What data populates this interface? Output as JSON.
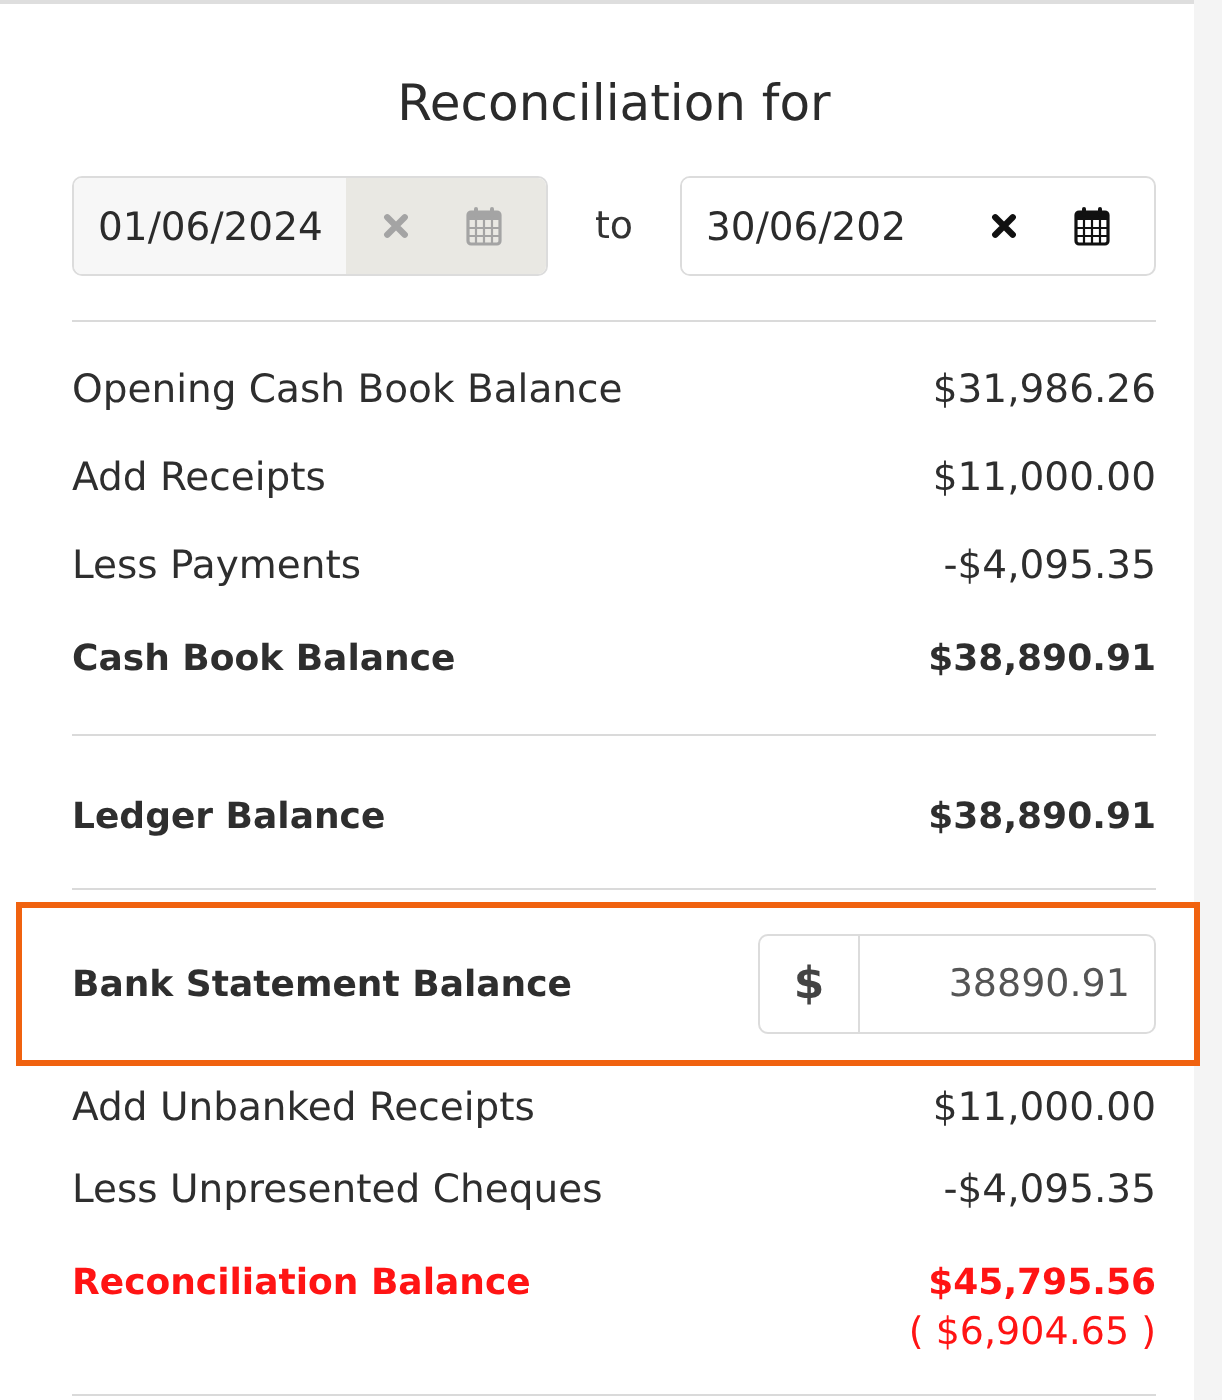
{
  "title": "Reconciliation for",
  "date_range": {
    "from": {
      "value": "01/06/2024",
      "disabled": true
    },
    "separator": "to",
    "to": {
      "value": "30/06/202",
      "disabled": false
    }
  },
  "sections": [
    {
      "rows": [
        {
          "label": "Opening Cash Book Balance",
          "amount": "$31,986.26",
          "total": false
        },
        {
          "label": "Add Receipts",
          "amount": "$11,000.00",
          "total": false
        },
        {
          "label": "Less Payments",
          "amount": "-$4,095.35",
          "total": false
        },
        {
          "label": "Cash Book Balance",
          "amount": "$38,890.91",
          "total": true
        }
      ]
    },
    {
      "rows": [
        {
          "label": "Ledger Balance",
          "amount": "$38,890.91",
          "total": true
        }
      ]
    }
  ],
  "bank_statement": {
    "label": "Bank Statement Balance",
    "currency": "$",
    "value": "38890.91",
    "highlighted": true
  },
  "adjustments": [
    {
      "label": "Add Unbanked Receipts",
      "amount": "$11,000.00"
    },
    {
      "label": "Less Unpresented Cheques",
      "amount": "-$4,095.35"
    }
  ],
  "reconciliation": {
    "label": "Reconciliation Balance",
    "amount": "$45,795.56",
    "difference": "( $6,904.65 )",
    "alert": true
  }
}
